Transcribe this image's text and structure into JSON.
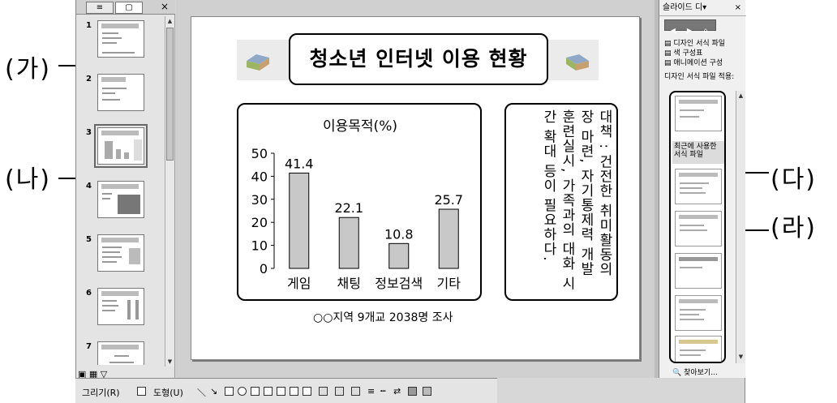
{
  "callouts": {
    "ga": "(가)",
    "na": "(나)",
    "da": "(다)",
    "ra": "(라)"
  },
  "slides_pane": {
    "numbers": [
      "1",
      "2",
      "3",
      "4",
      "5",
      "6",
      "7"
    ],
    "close": "×"
  },
  "slide": {
    "title": "청소년 인터넷 이용 현황",
    "body_text": "대책 : 건전한 취미활동의 장 마련, 자기통제력 개발 훈련실시, 가족과의 대화 시간 확대 등이 필요하다.",
    "caption": "○○지역 9개교 2038명 조사"
  },
  "chart_data": {
    "type": "bar",
    "title": "이용목적(%)",
    "categories": [
      "게임",
      "채팅",
      "정보검색",
      "기타"
    ],
    "values": [
      41.4,
      22.1,
      10.8,
      25.7
    ],
    "ylim": [
      0,
      50
    ],
    "yticks": [
      0,
      10,
      20,
      30,
      40,
      50
    ],
    "value_labels": [
      "41.4",
      "22.1",
      "10.8",
      "25.7"
    ],
    "xlabel": "",
    "ylabel": "",
    "grid": false,
    "legend": false
  },
  "task_pane": {
    "title": "슬라이드 디▾",
    "close": "×",
    "links": [
      "디자인 서식 파일",
      "색 구성표",
      "애니메이션 구성"
    ],
    "section_label": "디자인 서식 파일 적용:",
    "recent_label": "최근에 사용한 서식 파일",
    "search": "찾아보기..."
  },
  "toolbar": {
    "draw_menu": "그리기(R)",
    "shapes_menu": "도형(U)"
  },
  "colors": {
    "bar_fill": "#c8c8c8",
    "app_bg": "#d7d7d7",
    "slide_bg": "#ffffff"
  }
}
